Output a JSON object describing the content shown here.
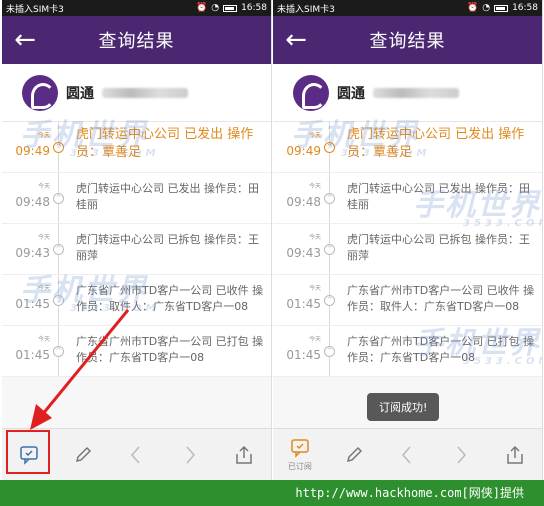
{
  "left": {
    "status": {
      "carrier": "未插入SIM卡3",
      "time": "16:58"
    },
    "header": {
      "title": "查询结果"
    },
    "company": {
      "name": "圆通"
    },
    "records": [
      {
        "day": "今天",
        "time": "09:49",
        "text": "虎门转运中心公司 已发出 操作员：覃善足",
        "active": true
      },
      {
        "day": "今天",
        "time": "09:48",
        "text": "虎门转运中心公司 已发出 操作员：田桂丽",
        "active": false
      },
      {
        "day": "今天",
        "time": "09:43",
        "text": "虎门转运中心公司 已拆包 操作员：王丽萍",
        "active": false
      },
      {
        "day": "今天",
        "time": "01:45",
        "text": "广东省广州市TD客户一公司 已收件 操作员：取件人：广东省TD客户一08",
        "active": false
      },
      {
        "day": "今天",
        "time": "01:45",
        "text": "广东省广州市TD客户一公司 已打包 操作员：广东省TD客户一08",
        "active": false
      }
    ],
    "bottom": {
      "subscribe_label": ""
    }
  },
  "right": {
    "status": {
      "carrier": "未插入SIM卡3",
      "time": "16:58"
    },
    "header": {
      "title": "查询结果"
    },
    "company": {
      "name": "圆通"
    },
    "records": [
      {
        "day": "今天",
        "time": "09:49",
        "text": "虎门转运中心公司 已发出 操作员：覃善足",
        "active": true
      },
      {
        "day": "今天",
        "time": "09:48",
        "text": "虎门转运中心公司 已发出 操作员：田桂丽",
        "active": false
      },
      {
        "day": "今天",
        "time": "09:43",
        "text": "虎门转运中心公司 已拆包 操作员：王丽萍",
        "active": false
      },
      {
        "day": "今天",
        "time": "01:45",
        "text": "广东省广州市TD客户一公司 已收件 操作员：取件人：广东省TD客户一08",
        "active": false
      },
      {
        "day": "今天",
        "time": "01:45",
        "text": "广东省广州市TD客户一公司 已打包 操作员：广东省TD客户一08",
        "active": false
      }
    ],
    "toast": "订阅成功!",
    "bottom": {
      "subscribe_label": "已订阅"
    }
  },
  "watermark": {
    "main": "手机世界",
    "sub": "3533.COM"
  },
  "footer": "http://www.hackhome.com[网侠]提供",
  "colors": {
    "header": "#4a2770",
    "accent": "#e08a1b",
    "highlight": "#e02020",
    "footer": "#2d8f2d"
  },
  "icons": [
    "back-arrow-icon",
    "message-icon",
    "pencil-icon",
    "chevron-left-icon",
    "chevron-right-icon",
    "share-icon"
  ]
}
